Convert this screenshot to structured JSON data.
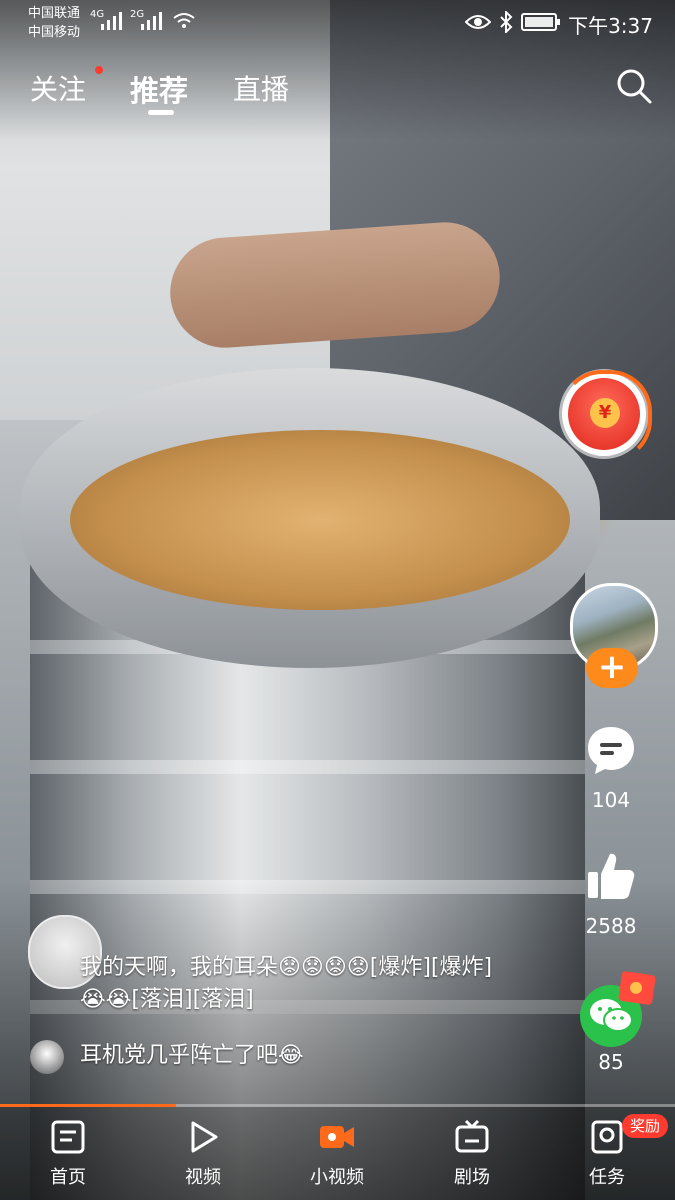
{
  "status_bar": {
    "carrier_1": "中国联通",
    "carrier_2": "中国移动",
    "net_1": "4G",
    "net_2": "2G",
    "time": "下午3:37"
  },
  "top_tabs": [
    {
      "label": "关注",
      "has_dot": true
    },
    {
      "label": "推荐",
      "active": true
    },
    {
      "label": "直播"
    }
  ],
  "right_rail": {
    "comment_count": "104",
    "like_count": "2588",
    "share_count": "85"
  },
  "comments": [
    {
      "text": "我的天啊，我的耳朵😟😟😟😟[爆炸][爆炸]😭😭[落泪][落泪]"
    },
    {
      "text": "耳机党几乎阵亡了吧😂"
    }
  ],
  "progress": {
    "fraction": 0.26
  },
  "bottom_nav": [
    {
      "label": "首页",
      "icon": "home-icon"
    },
    {
      "label": "视频",
      "icon": "play-icon"
    },
    {
      "label": "小视频",
      "icon": "camera-icon",
      "active": true
    },
    {
      "label": "剧场",
      "icon": "tv-icon"
    },
    {
      "label": "任务",
      "icon": "task-icon"
    }
  ],
  "reward_badge": "奖励",
  "colors": {
    "accent": "#ff6a1a",
    "wechat": "#2bc24b",
    "badge": "#ff3b30"
  }
}
